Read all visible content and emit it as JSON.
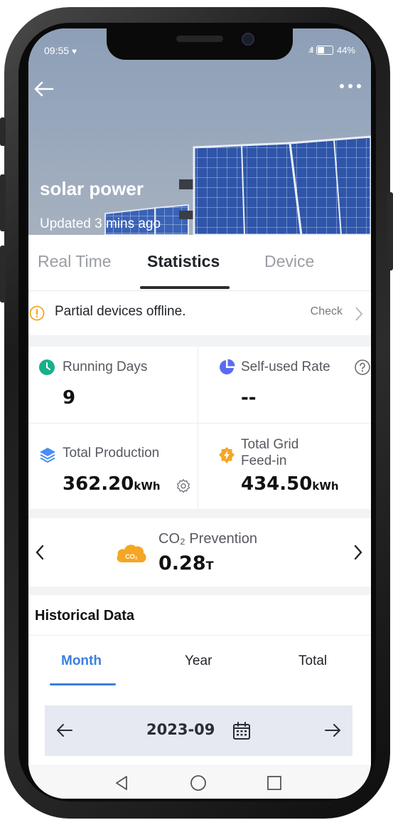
{
  "status_bar": {
    "time": "09:55",
    "battery": "44%"
  },
  "header": {
    "title": "solar power",
    "updated": "Updated 3 mins ago"
  },
  "tabs": [
    {
      "label": "Real Time"
    },
    {
      "label": "Statistics"
    },
    {
      "label": "Device"
    }
  ],
  "notice": {
    "text": "Partial devices offline.",
    "action": "Check"
  },
  "stats": {
    "running_days": {
      "label": "Running Days",
      "value": "9"
    },
    "self_used_rate": {
      "label": "Self-used Rate",
      "value": "--"
    },
    "total_production": {
      "label": "Total Production",
      "value": "362.20",
      "unit": "kWh"
    },
    "total_grid_feed_in": {
      "label_line1": "Total Grid",
      "label_line2": "Feed-in",
      "value": "434.50",
      "unit": "kWh"
    }
  },
  "co2": {
    "label": "CO₂ Prevention",
    "value": "0.28",
    "unit": "T",
    "badge": "CO₂"
  },
  "historical": {
    "title": "Historical Data",
    "periods": [
      "Month",
      "Year",
      "Total"
    ],
    "date": "2023-09"
  },
  "colors": {
    "accent_blue": "#3b7fe0",
    "running_days_icon": "#1aaf8b",
    "self_used_icon": "#5b6cf0",
    "production_icon": "#4a8df0",
    "feed_in_icon": "#f5a623",
    "co2_icon": "#f5a623",
    "warning": "#f5a623"
  },
  "icons": {
    "back": "arrow-left-icon",
    "more": "more-horizontal-icon",
    "warning": "warning-circle-icon",
    "running_days": "clock-icon",
    "self_used_rate": "pie-chart-icon",
    "help": "question-circle-icon",
    "total_production": "layers-icon",
    "grid_feed_in": "lightning-icon",
    "settings": "gear-icon",
    "co2": "co2-cloud-icon",
    "calendar": "calendar-icon"
  }
}
